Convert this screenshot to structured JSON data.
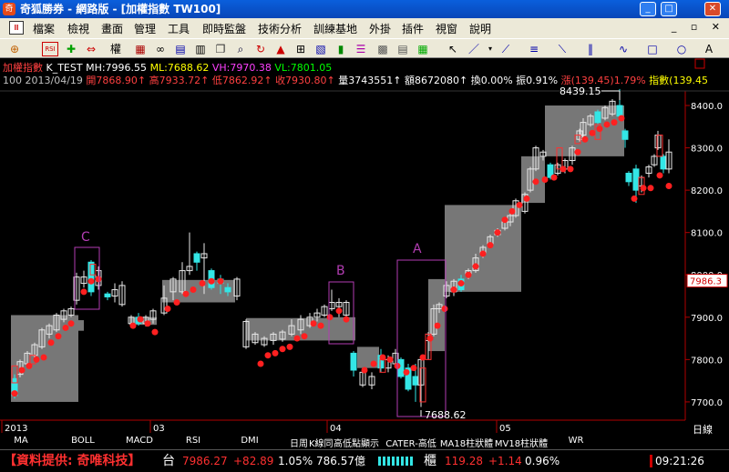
{
  "window": {
    "title": "奇狐勝券 - 網路版 - [加權指數 TW100]",
    "min_icon": "minimize-icon",
    "max_icon": "maximize-icon",
    "close_icon": "close-icon"
  },
  "menu": {
    "items": [
      "檔案",
      "檢視",
      "畫面",
      "管理",
      "工具",
      "即時監盤",
      "技術分析",
      "訓練基地",
      "外掛",
      "插件",
      "視窗",
      "說明"
    ]
  },
  "toolbar": {
    "rsi_label": "RSI",
    "bar_label": "權"
  },
  "info": {
    "symbol": "加權指數",
    "k_label": "K_TEST",
    "mh": "MH:7996.55",
    "ml": "ML:7688.62",
    "vh": "VH:7970.38",
    "vl": "VL:7801.05",
    "period": "100",
    "date": "2013/04/19",
    "open": "開7868.90↑",
    "high": "高7933.72↑",
    "low": "低7862.92↑",
    "close": "收7930.80↑",
    "vol": "量3743551↑",
    "amt": "額8672080↑",
    "turnover": "換0.00%",
    "amp": "振0.91%",
    "chg": "漲(139.45)1.79%",
    "idx": "指數(139.45"
  },
  "chart": {
    "price_axis": [
      "8400.0",
      "8300.0",
      "8200.0",
      "8100.0",
      "8000.0",
      "7900.0",
      "7800.0",
      "7700.0"
    ],
    "current_price": "7986.3",
    "box_labels": [
      "A",
      "B",
      "C"
    ],
    "high_mark": "8439.15",
    "low_mark": "7688.62",
    "month_labels": [
      "2013",
      "03",
      "04",
      "05"
    ],
    "period_label": "日線",
    "colors": {
      "up": "#e8e8e8",
      "down": "#33e6e6",
      "dot": "#ff2020",
      "box": "#777777",
      "rect": "#b23db2",
      "axis": "#b00000"
    }
  },
  "tabs": [
    "MA",
    "BOLL",
    "MACD",
    "RSI",
    "DMI",
    "日周",
    "K線同",
    "高低點顯示",
    "CATER-高低",
    "MA18柱狀體",
    "MV18柱狀體",
    "WR"
  ],
  "status": {
    "provider": "【資料提供: 奇唯科技】",
    "tai": "台",
    "tai_price": "7986.27",
    "tai_chg": "+82.89",
    "tai_pct": "1.05%",
    "tai_vol": "786.57億",
    "gui": "櫃",
    "gui_price": "119.28",
    "gui_chg": "+1.14",
    "gui_pct": "0.96%",
    "time": "09:21:26"
  }
}
